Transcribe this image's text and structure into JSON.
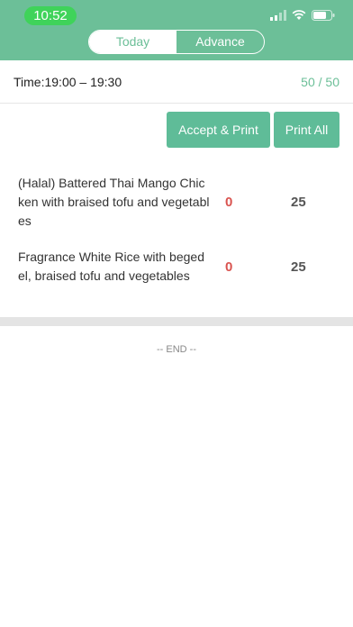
{
  "status_bar": {
    "time": "10:52"
  },
  "tabs": [
    {
      "label": "Today",
      "active": true
    },
    {
      "label": "Advance",
      "active": false
    }
  ],
  "time_slot": {
    "label": "Time:19:00 – 19:30",
    "count": "50 / 50"
  },
  "actions": {
    "accept_print": "Accept & Print",
    "print_all": "Print All"
  },
  "items": [
    {
      "name": "(Halal) Battered Thai Mango Chicken with braised tofu and vegetables",
      "zero": "0",
      "qty": "25"
    },
    {
      "name": "Fragrance White Rice with begedel, braised tofu and vegetables",
      "zero": "0",
      "qty": "25"
    }
  ],
  "footer": {
    "end_label": "-- END --"
  },
  "colors": {
    "header": "#6cbf98",
    "accent": "#5fbc98",
    "zero": "#d9534f",
    "pill": "#3fd35a"
  }
}
